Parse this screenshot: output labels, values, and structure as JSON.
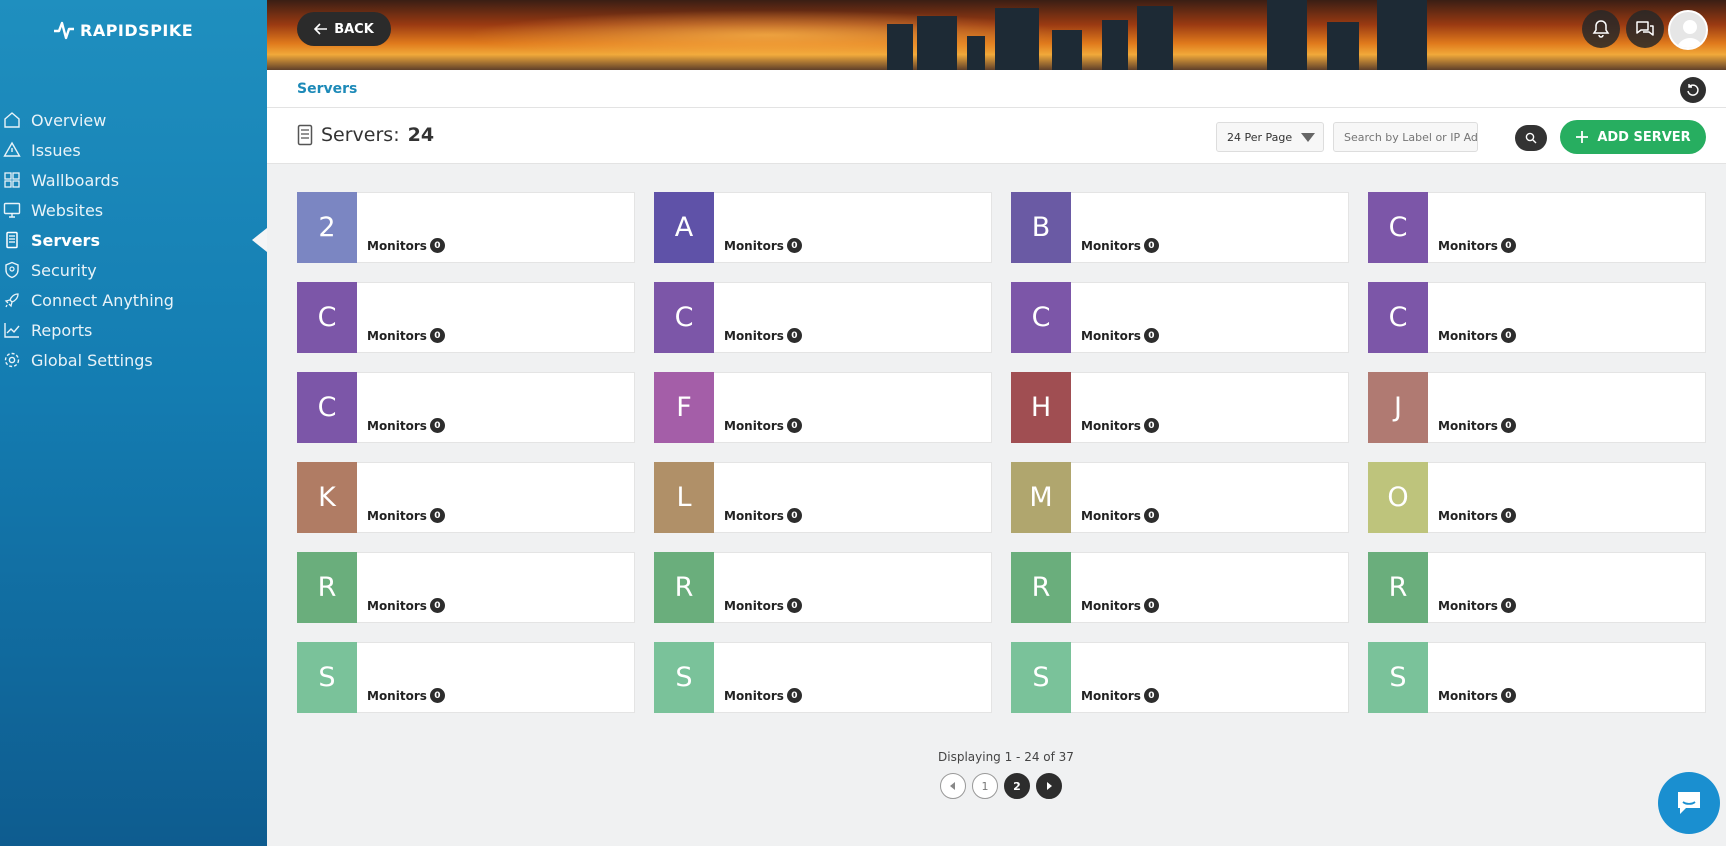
{
  "brand": {
    "name": "RAPIDSPIKE"
  },
  "sidebar": {
    "items": [
      {
        "label": "Overview",
        "icon": "home-icon"
      },
      {
        "label": "Issues",
        "icon": "warning-icon"
      },
      {
        "label": "Wallboards",
        "icon": "grid-icon"
      },
      {
        "label": "Websites",
        "icon": "monitor-icon"
      },
      {
        "label": "Servers",
        "icon": "server-icon",
        "active": true
      },
      {
        "label": "Security",
        "icon": "shield-icon"
      },
      {
        "label": "Connect Anything",
        "icon": "rocket-icon"
      },
      {
        "label": "Reports",
        "icon": "chart-icon"
      },
      {
        "label": "Global Settings",
        "icon": "gear-icon"
      }
    ]
  },
  "header": {
    "back_label": "BACK",
    "icons": [
      "bell-icon",
      "chat-bubbles-icon",
      "avatar"
    ]
  },
  "breadcrumb": {
    "current": "Servers"
  },
  "toolbar": {
    "title": "Servers:",
    "count": "24",
    "per_page": "24 Per Page",
    "search_placeholder": "Search by Label or IP Address",
    "add_label": "ADD SERVER"
  },
  "servers": {
    "monitors_label": "Monitors",
    "items": [
      {
        "letter": "2",
        "color": "#7b86c2",
        "monitors": "0"
      },
      {
        "letter": "A",
        "color": "#5f52a8",
        "monitors": "0"
      },
      {
        "letter": "B",
        "color": "#6a5aa4",
        "monitors": "0"
      },
      {
        "letter": "C",
        "color": "#7c56a8",
        "monitors": "0"
      },
      {
        "letter": "C",
        "color": "#7c56a8",
        "monitors": "0"
      },
      {
        "letter": "C",
        "color": "#7c56a8",
        "monitors": "0"
      },
      {
        "letter": "C",
        "color": "#7c56a8",
        "monitors": "0"
      },
      {
        "letter": "C",
        "color": "#7c56a8",
        "monitors": "0"
      },
      {
        "letter": "C",
        "color": "#7c56a8",
        "monitors": "0"
      },
      {
        "letter": "F",
        "color": "#a45ea8",
        "monitors": "0"
      },
      {
        "letter": "H",
        "color": "#a04e52",
        "monitors": "0"
      },
      {
        "letter": "J",
        "color": "#b07a72",
        "monitors": "0"
      },
      {
        "letter": "K",
        "color": "#b07c64",
        "monitors": "0"
      },
      {
        "letter": "L",
        "color": "#b09068",
        "monitors": "0"
      },
      {
        "letter": "M",
        "color": "#b0a66e",
        "monitors": "0"
      },
      {
        "letter": "O",
        "color": "#bec47c",
        "monitors": "0"
      },
      {
        "letter": "R",
        "color": "#6aae7c",
        "monitors": "0"
      },
      {
        "letter": "R",
        "color": "#6aae7c",
        "monitors": "0"
      },
      {
        "letter": "R",
        "color": "#6aae7c",
        "monitors": "0"
      },
      {
        "letter": "R",
        "color": "#6aae7c",
        "monitors": "0"
      },
      {
        "letter": "S",
        "color": "#7ac29a",
        "monitors": "0"
      },
      {
        "letter": "S",
        "color": "#7ac29a",
        "monitors": "0"
      },
      {
        "letter": "S",
        "color": "#7ac29a",
        "monitors": "0"
      },
      {
        "letter": "S",
        "color": "#7ac29a",
        "monitors": "0"
      }
    ]
  },
  "pagination": {
    "summary": "Displaying 1 - 24 of 37",
    "pages": [
      "1",
      "2"
    ],
    "current": "2"
  }
}
